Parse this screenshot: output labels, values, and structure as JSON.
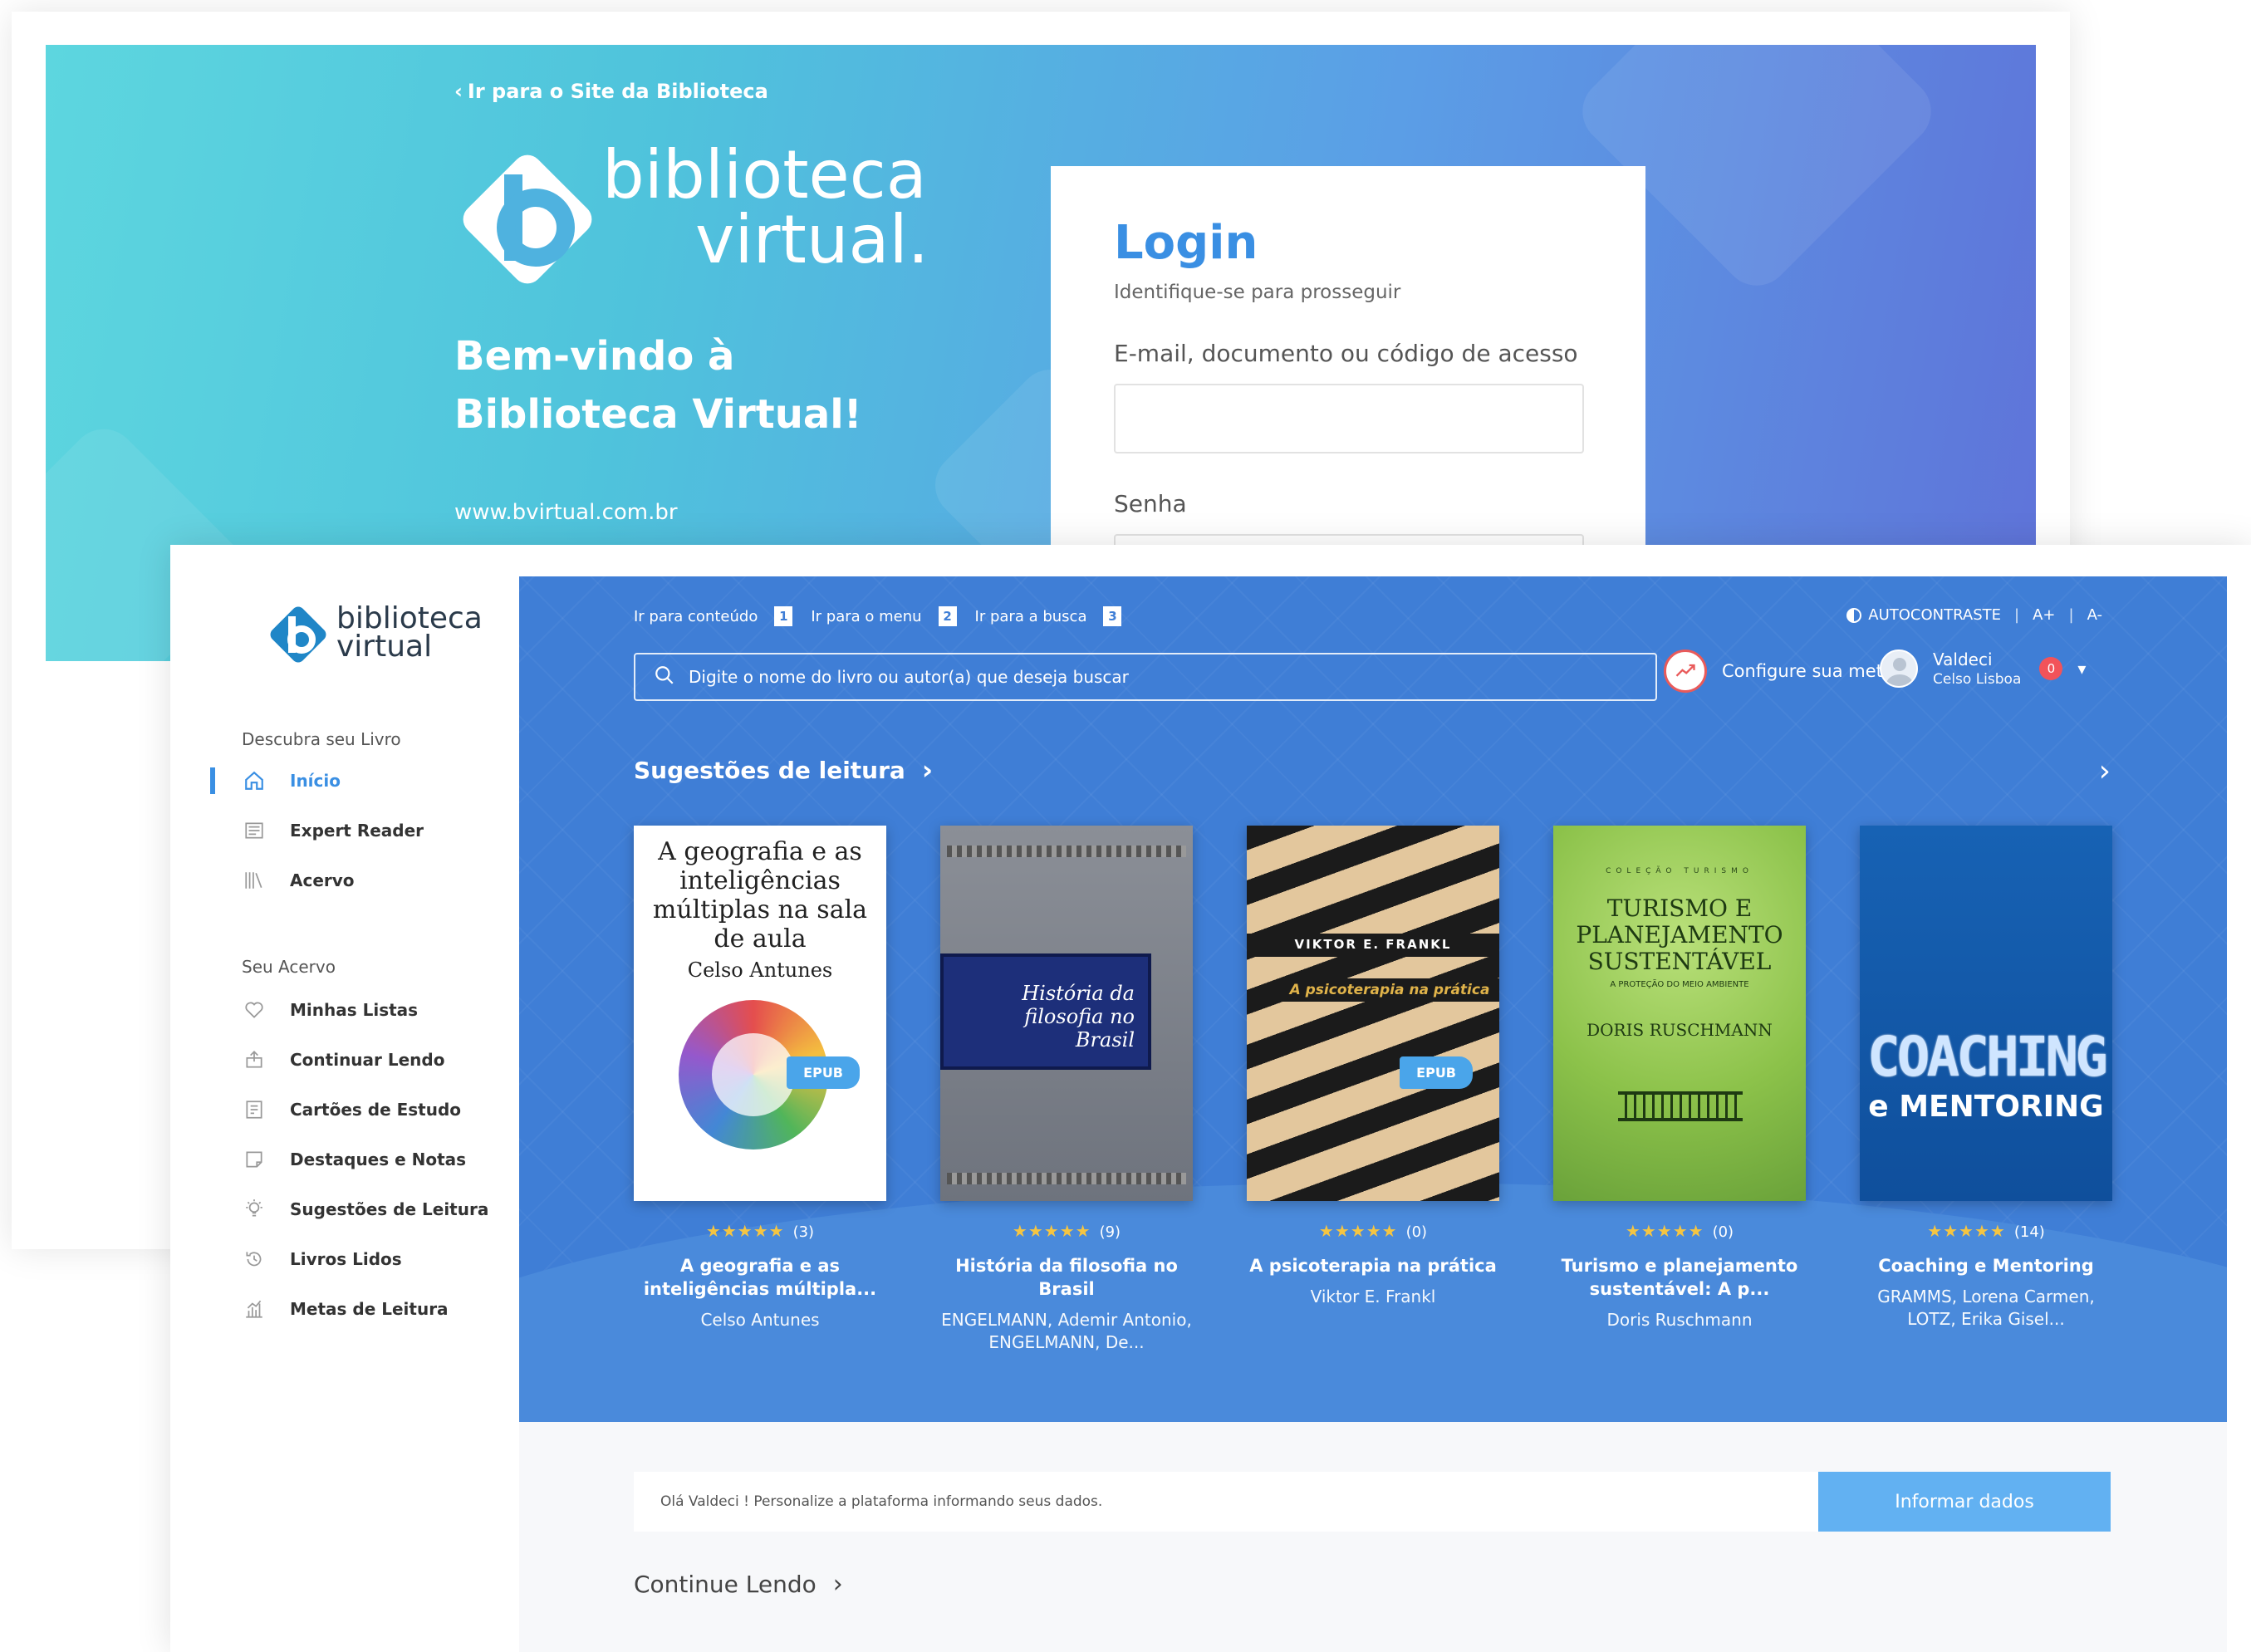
{
  "login": {
    "back_link": "Ir para o Site da Biblioteca",
    "logo_line1": "biblioteca",
    "logo_line2": "virtual.",
    "welcome_line1": "Bem-vindo à",
    "welcome_line2": "Biblioteca Virtual!",
    "site_url": "www.bvirtual.com.br",
    "title": "Login",
    "subtitle": "Identifique-se para prosseguir",
    "email_label": "E-mail, documento ou código de acesso",
    "password_label": "Senha"
  },
  "app": {
    "logo_line1": "biblioteca",
    "logo_line2": "virtual",
    "sidebar": {
      "section1": "Descubra seu Livro",
      "section2": "Seu Acervo",
      "items": [
        {
          "label": "Início",
          "icon": "home-icon"
        },
        {
          "label": "Expert Reader",
          "icon": "reader-icon"
        },
        {
          "label": "Acervo",
          "icon": "collection-icon"
        },
        {
          "label": "Minhas Listas",
          "icon": "heart-icon"
        },
        {
          "label": "Continuar Lendo",
          "icon": "continue-reading-icon"
        },
        {
          "label": "Cartões de Estudo",
          "icon": "study-cards-icon"
        },
        {
          "label": "Destaques e Notas",
          "icon": "notes-icon"
        },
        {
          "label": "Sugestões de Leitura",
          "icon": "lightbulb-icon"
        },
        {
          "label": "Livros Lidos",
          "icon": "history-icon"
        },
        {
          "label": "Metas de Leitura",
          "icon": "goals-chart-icon"
        }
      ]
    },
    "skip_links": [
      {
        "label": "Ir para conteúdo",
        "key": "1"
      },
      {
        "label": "Ir para o menu",
        "key": "2"
      },
      {
        "label": "Ir para a busca",
        "key": "3"
      }
    ],
    "a11y": {
      "contrast": "AUTOCONTRASTE",
      "font_up": "A+",
      "font_down": "A-"
    },
    "search": {
      "placeholder": "Digite o nome do livro ou autor(a) que deseja buscar"
    },
    "goal_label": "Configure sua meta",
    "user": {
      "name": "Valdeci",
      "subtitle": "Celso Lisboa",
      "notifications": "0"
    },
    "suggestions_title": "Sugestões de leitura",
    "books": [
      {
        "title": "A geografia e as inteligências múltipla...",
        "author": "Celso Antunes",
        "stars": "★★★★★",
        "count": "(3)",
        "epub": "EPUB",
        "cover_title": "A geografia e as inteligências múltiplas na sala de aula",
        "cover_author": "Celso Antunes"
      },
      {
        "title": "História da filosofia no Brasil",
        "author": "ENGELMANN, Ademir Antonio, ENGELMANN, De...",
        "stars": "★★★★★",
        "count": "(9)",
        "cover_title": "História da filosofia no Brasil"
      },
      {
        "title": "A psicoterapia na prática",
        "author": "Viktor E. Frankl",
        "stars": "★★★★★",
        "count": "(0)",
        "epub": "EPUB",
        "cover_title": "A psicoterapia na prática",
        "cover_author": "VIKTOR E. FRANKL"
      },
      {
        "title": "Turismo e planejamento sustentável: A p...",
        "author": "Doris Ruschmann",
        "stars": "★★★★★",
        "count": "(0)",
        "cover_series": "COLEÇÃO TURISMO",
        "cover_title": "TURISMO E PLANEJAMENTO SUSTENTÁVEL",
        "cover_sub": "A PROTEÇÃO DO MEIO AMBIENTE",
        "cover_author": "DORIS RUSCHMANN"
      },
      {
        "title": "Coaching e Mentoring",
        "author": "GRAMMS, Lorena Carmen, LOTZ, Erika Gisel...",
        "stars": "★★★★★",
        "count": "(14)",
        "cover_title1": "COACHING",
        "cover_title2": "e MENTORING"
      }
    ],
    "profile_banner": {
      "message": "Olá Valdeci ! Personalize a plataforma informando seus dados.",
      "button": "Informar dados"
    },
    "continue_title": "Continue Lendo",
    "colors": {
      "primary": "#3a8fe3",
      "hero": "#3f7ed6",
      "button": "#62b1f2",
      "star": "#f5c542",
      "badge": "#f2535a"
    }
  }
}
